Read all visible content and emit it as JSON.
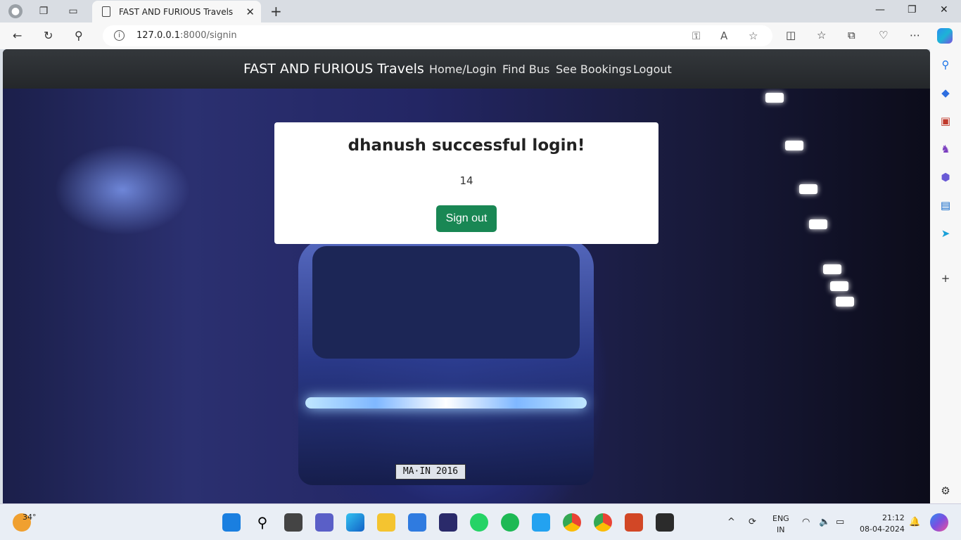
{
  "browser": {
    "tab_title": "FAST AND FURIOUS Travels",
    "url_host": "127.0.0.1",
    "url_rest": ":8000/signin"
  },
  "site": {
    "brand": "FAST AND FURIOUS Travels",
    "nav": [
      "Home/Login",
      "Find Bus",
      "See Bookings",
      "Logout"
    ]
  },
  "card": {
    "heading": "dhanush successful login!",
    "value": "14",
    "button": "Sign out"
  },
  "image": {
    "plate": "MA·IN 2016"
  },
  "taskbar": {
    "weather": "34°",
    "lang": "ENG",
    "region": "IN",
    "time": "21:12",
    "date": "08-04-2024"
  },
  "colors": {
    "accent_button": "#198754",
    "navbar": "#2b2e31"
  }
}
